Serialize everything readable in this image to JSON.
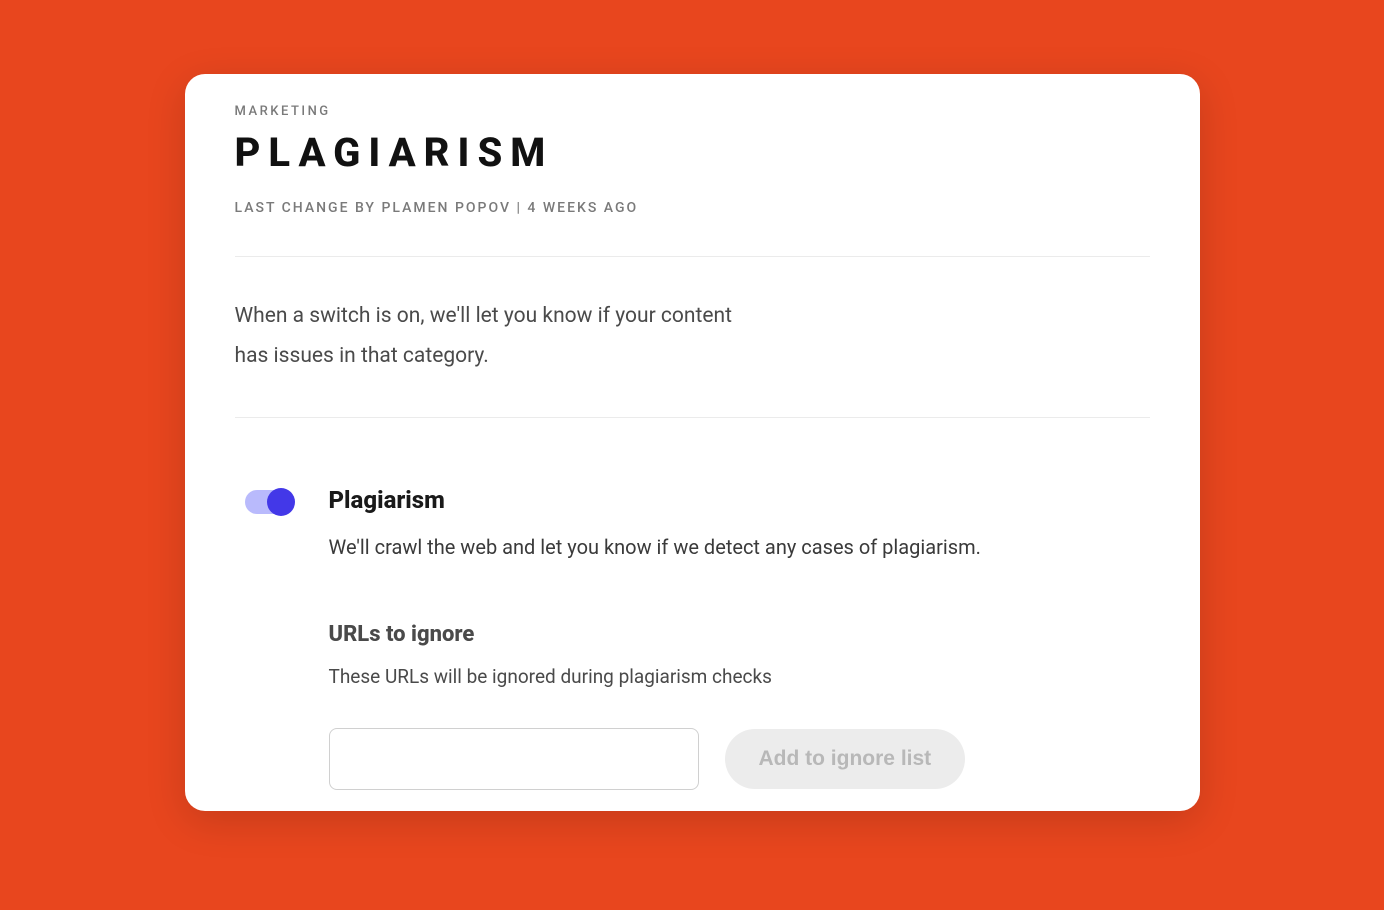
{
  "header": {
    "breadcrumb": "MARKETING",
    "title": "PLAGIARISM",
    "meta": "LAST CHANGE BY PLAMEN POPOV | 4 WEEKS AGO"
  },
  "intro": "When a switch is on, we'll let you know if your content has issues in that category.",
  "setting": {
    "toggle_on": true,
    "title": "Plagiarism",
    "description": "We'll crawl the web and let you know if we detect any cases of plagiarism.",
    "urls_section": {
      "title": "URLs to ignore",
      "description": "These URLs will be ignored during plagiarism checks",
      "input_value": "",
      "button_label": "Add to ignore list"
    }
  },
  "colors": {
    "background": "#e8461e",
    "toggle_track": "#b9bafc",
    "toggle_knob": "#4338e8"
  }
}
